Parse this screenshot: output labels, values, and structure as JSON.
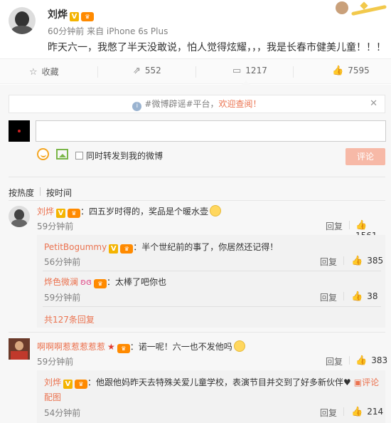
{
  "post": {
    "author": "刘烨",
    "meta": "60分钟前 来自 iPhone 6s Plus",
    "text": "昨天六一，我憋了半天没敢说，怕人觉得炫耀，，，我是长春市健美儿童！！！"
  },
  "actions": {
    "favorite": "收藏",
    "repost": "552",
    "comments": "1217",
    "likes": "7595"
  },
  "notice": {
    "tag": "#微博辟谣#平台，",
    "link": "欢迎查阅！"
  },
  "composer": {
    "repost_option": "同时转发到我的微博",
    "submit": "评论"
  },
  "sort": {
    "hot": "按热度",
    "time": "按时间"
  },
  "comments": [
    {
      "user": "刘烨",
      "text": "：四五岁时得的，奖品是个暖水壶",
      "time": "59分钟前",
      "reply": "回复",
      "likes": "1561",
      "replies": [
        {
          "user": "PetitBogummy",
          "text": "：半个世纪前的事了，你居然还记得！",
          "time": "56分钟前",
          "reply": "回复",
          "likes": "385"
        },
        {
          "user": "烨色微澜",
          "text": "：太棒了吧你也",
          "time": "59分钟前",
          "reply": "回复",
          "likes": "38"
        }
      ],
      "more": "共127条回复"
    },
    {
      "user": "啊啊啊惹惹惹惹惹",
      "text": "：诺一呢！六一也不发他吗",
      "time": "59分钟前",
      "reply": "回复",
      "likes": "383",
      "replies": [
        {
          "user": "刘烨",
          "text": "：他跟他妈昨天去特殊关爱儿童学校，表演节目并交到了好多新伙伴",
          "extra": "评论",
          "extra2": "配图",
          "time": "54分钟前",
          "reply": "回复",
          "likes": "214"
        }
      ]
    }
  ]
}
